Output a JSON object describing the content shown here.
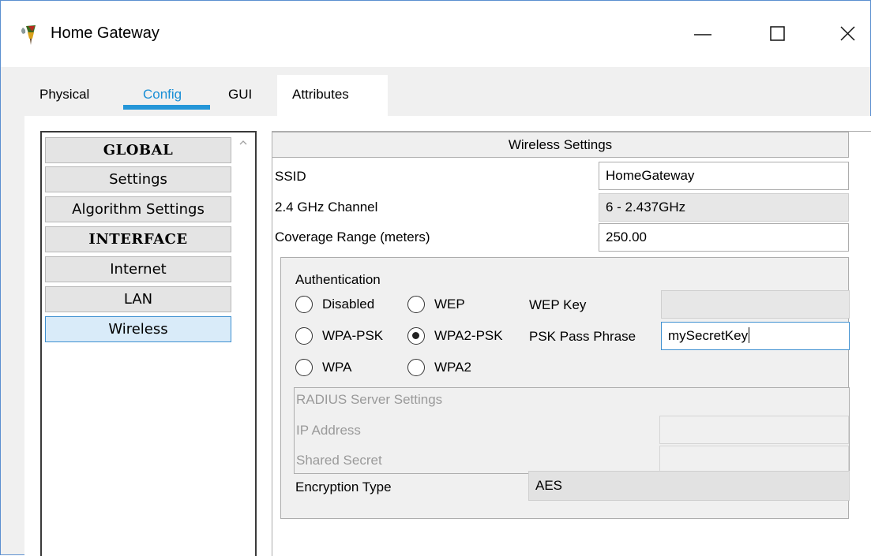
{
  "window": {
    "title": "Home Gateway",
    "icon": "cisco-router-icon",
    "controls": [
      "minimize-icon",
      "maximize-icon",
      "close-icon"
    ]
  },
  "tabs": [
    {
      "label": "Physical",
      "active": false
    },
    {
      "label": "Config",
      "active": true
    },
    {
      "label": "GUI",
      "active": false
    },
    {
      "label": "Attributes",
      "active": false
    }
  ],
  "sidebar": {
    "items": [
      {
        "label": "GLOBAL",
        "type": "header"
      },
      {
        "label": "Settings",
        "type": "item"
      },
      {
        "label": "Algorithm Settings",
        "type": "item"
      },
      {
        "label": "INTERFACE",
        "type": "header"
      },
      {
        "label": "Internet",
        "type": "item"
      },
      {
        "label": "LAN",
        "type": "item"
      },
      {
        "label": "Wireless",
        "type": "item",
        "selected": true
      }
    ]
  },
  "wireless": {
    "section_title": "Wireless Settings",
    "ssid": {
      "label": "SSID",
      "value": "HomeGateway"
    },
    "channel": {
      "label": "2.4 GHz Channel",
      "value": "6 - 2.437GHz"
    },
    "coverage": {
      "label": "Coverage Range (meters)",
      "value": "250.00"
    },
    "authentication": {
      "label": "Authentication",
      "options": [
        {
          "label": "Disabled",
          "selected": false
        },
        {
          "label": "WEP",
          "selected": false
        },
        {
          "label": "WPA-PSK",
          "selected": false
        },
        {
          "label": "WPA2-PSK",
          "selected": true
        },
        {
          "label": "WPA",
          "selected": false
        },
        {
          "label": "WPA2",
          "selected": false
        }
      ],
      "wep_key_label": "WEP Key",
      "wep_key_value": "",
      "psk_label": "PSK Pass Phrase",
      "psk_value": "mySecretKey"
    },
    "radius": {
      "title": "RADIUS Server Settings",
      "ip_label": "IP Address",
      "secret_label": "Shared Secret"
    },
    "encryption": {
      "label": "Encryption Type",
      "value": "AES"
    }
  }
}
